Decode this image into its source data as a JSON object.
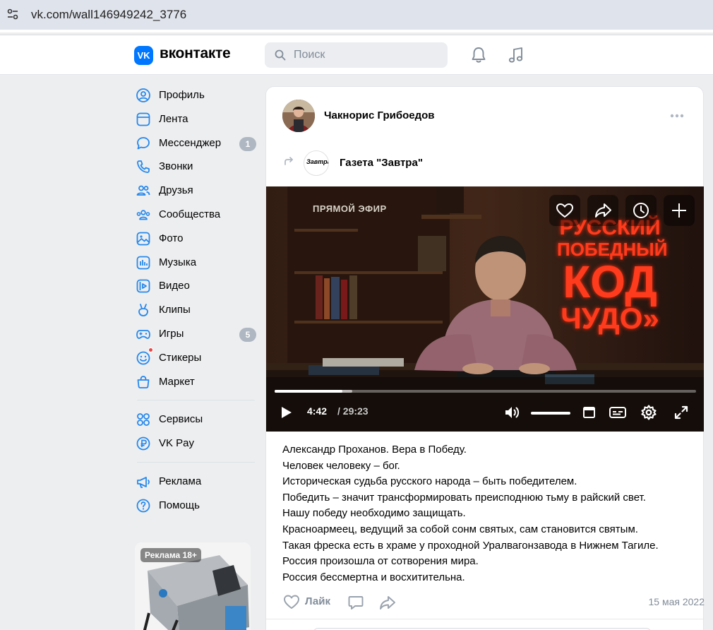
{
  "browser": {
    "url": "vk.com/wall146949242_3776"
  },
  "header": {
    "logo_text": "VK",
    "brand": "вконтакте",
    "search_placeholder": "Поиск",
    "icons": [
      "site-settings-icon",
      "search-icon",
      "bell-icon",
      "music-note-icon"
    ]
  },
  "sidebar": {
    "items": [
      {
        "label": "Профиль",
        "icon": "profile-icon"
      },
      {
        "label": "Лента",
        "icon": "feed-icon"
      },
      {
        "label": "Мессенджер",
        "icon": "messenger-icon",
        "badge": "1"
      },
      {
        "label": "Звонки",
        "icon": "phone-icon"
      },
      {
        "label": "Друзья",
        "icon": "friends-icon"
      },
      {
        "label": "Сообщества",
        "icon": "communities-icon"
      },
      {
        "label": "Фото",
        "icon": "photo-icon"
      },
      {
        "label": "Музыка",
        "icon": "music-icon"
      },
      {
        "label": "Видео",
        "icon": "video-icon"
      },
      {
        "label": "Клипы",
        "icon": "clips-icon"
      },
      {
        "label": "Игры",
        "icon": "games-icon",
        "badge": "5"
      },
      {
        "label": "Стикеры",
        "icon": "stickers-icon"
      },
      {
        "label": "Маркет",
        "icon": "market-icon"
      }
    ],
    "secondary": [
      {
        "label": "Сервисы",
        "icon": "services-icon"
      },
      {
        "label": "VK Pay",
        "icon": "vkpay-icon"
      }
    ],
    "tertiary": [
      {
        "label": "Реклама",
        "icon": "megaphone-icon"
      },
      {
        "label": "Помощь",
        "icon": "help-icon"
      }
    ],
    "ad_badge": "Реклама 18+"
  },
  "post": {
    "author": "Чакнорис Грибоедов",
    "source": "Газета \"Завтра\"",
    "source_avatar_text": "Завтра",
    "video": {
      "live_label": "ПРЯМОЙ ЭФИР",
      "neon_lines": [
        "РУССКИЙ",
        "ПОБЕДНЫЙ",
        "КОД",
        "ЧУДО»"
      ],
      "time_current": "4:42",
      "time_total": "/ 29:23",
      "progress": 0.16,
      "buffered": 0.185,
      "volume": 1.0
    },
    "text_lines": [
      "Александр Проханов. Вера в Победу.",
      "Человек человеку – бог.",
      "Историческая судьба русского народа – быть победителем.",
      "Победить – значит трансформировать преисподнюю тьму в райский свет.",
      "Нашу победу необходимо защищать.",
      "Красноармеец, ведущий за собой сонм святых, сам становится святым.",
      "Такая фреска есть в храме у проходной Уралвагонзавода в Нижнем Тагиле.",
      "Россия произошла от сотворения мира.",
      "Россия бессмертна и восхитительна."
    ],
    "like_label": "Лайк",
    "date": "15 мая 2022"
  },
  "colors": {
    "accent": "#0077ff",
    "page_bg": "#edeef0",
    "badge": "#aeb7c2",
    "muted": "#818c99"
  }
}
